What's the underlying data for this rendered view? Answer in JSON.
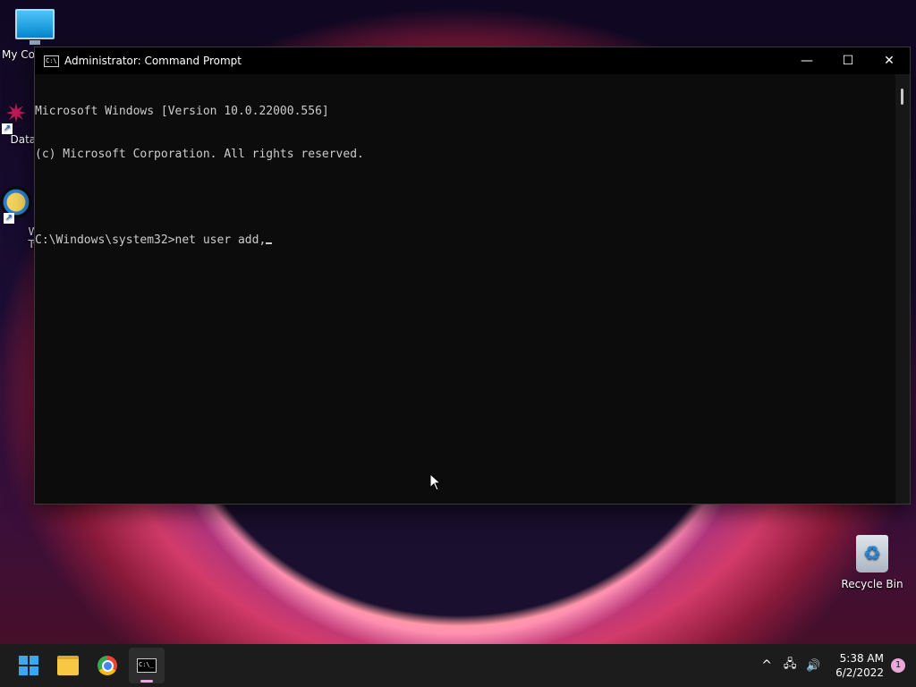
{
  "desktop": {
    "icons": [
      {
        "label": "My Co",
        "icon": "monitor-icon"
      },
      {
        "label": "DataW",
        "icon": "shortcut-icon"
      },
      {
        "label": "Win",
        "label2": "Twe",
        "icon": "shortcut-icon"
      },
      {
        "label": "Recycle Bin",
        "icon": "recycle-bin-icon"
      }
    ]
  },
  "window": {
    "title": "Administrator: Command Prompt",
    "icon": "cmd-icon",
    "controls": {
      "minimize": "—",
      "maximize": "☐",
      "close": "✕"
    },
    "console_lines": [
      "Microsoft Windows [Version 10.0.22000.556]",
      "(c) Microsoft Corporation. All rights reserved.",
      "",
      "C:\\Windows\\system32>net user add,"
    ]
  },
  "taskbar": {
    "apps": [
      "start-icon",
      "file-explorer-icon",
      "chrome-icon",
      "command-prompt-icon"
    ],
    "tray": {
      "chevron": "^",
      "network": "🖧",
      "volume": "🔊",
      "time": "5:38 AM",
      "date": "6/2/2022",
      "notification_count": "1"
    }
  }
}
